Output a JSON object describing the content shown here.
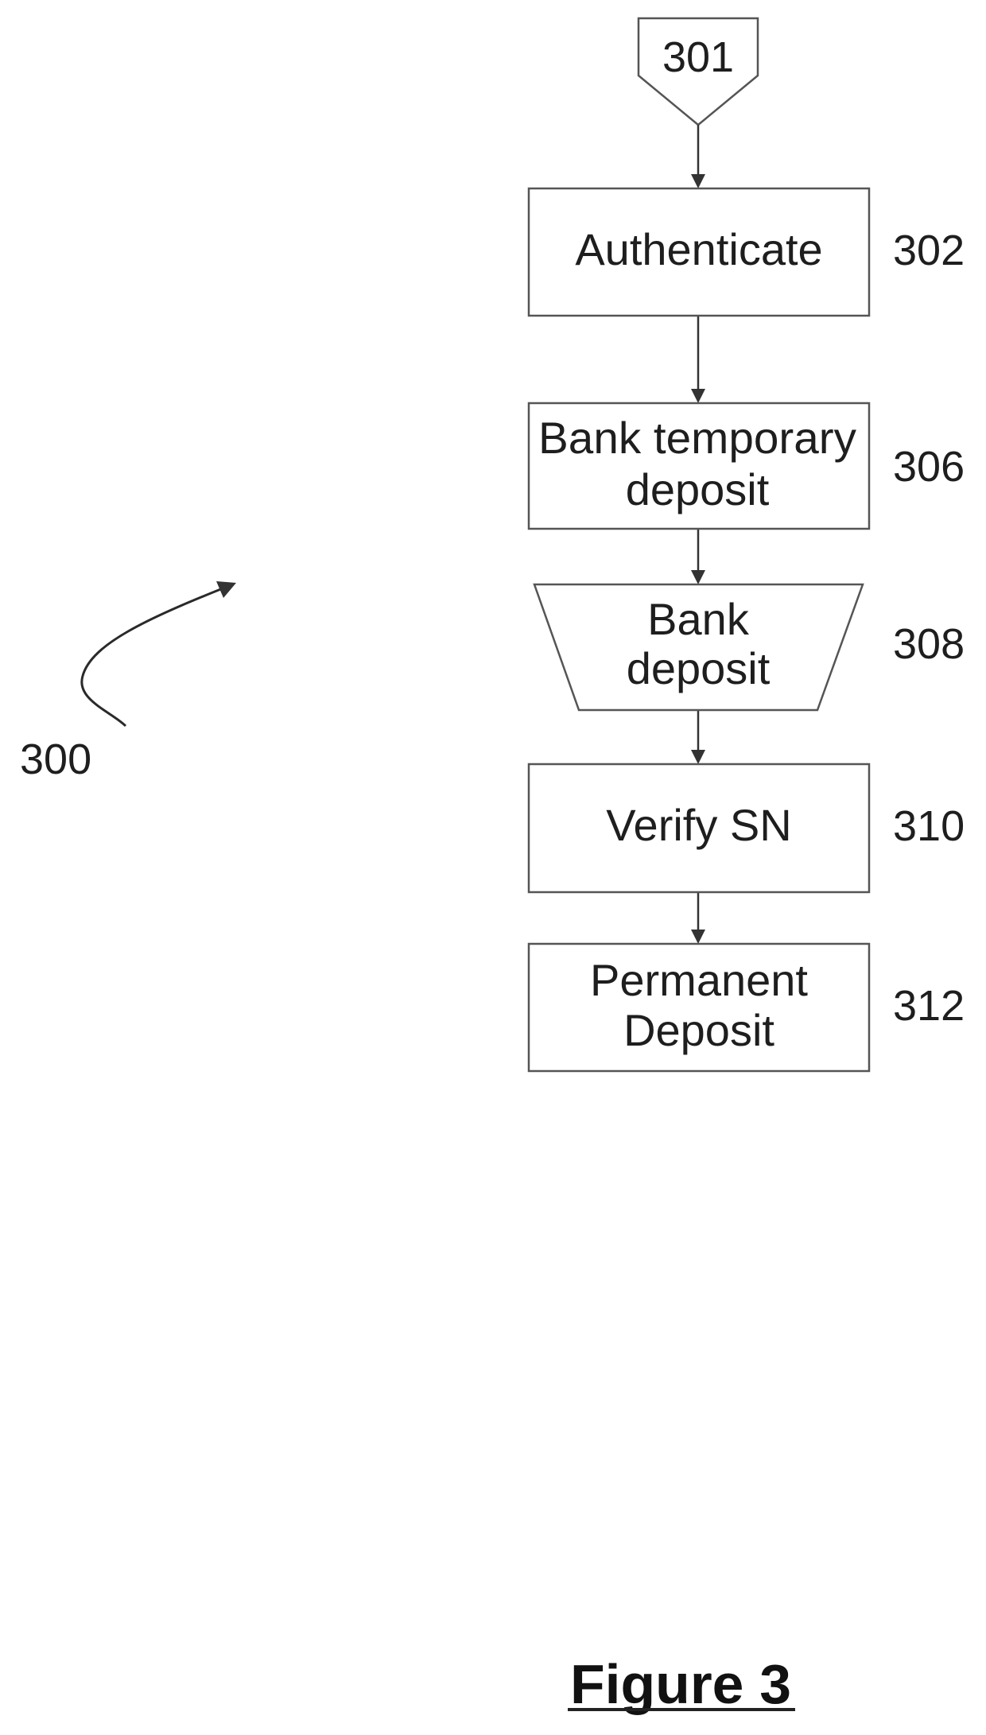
{
  "figure": {
    "caption": "Figure 3",
    "reference": "300"
  },
  "flow": {
    "start": {
      "ref": "301",
      "shape": "off-page-connector"
    },
    "steps": [
      {
        "ref": "302",
        "shape": "rectangle",
        "lines": [
          "Authenticate"
        ]
      },
      {
        "ref": "306",
        "shape": "rectangle",
        "lines": [
          "Bank temporary",
          "deposit"
        ]
      },
      {
        "ref": "308",
        "shape": "trapezoid",
        "lines": [
          "Bank",
          "deposit"
        ]
      },
      {
        "ref": "310",
        "shape": "rectangle",
        "lines": [
          "Verify SN"
        ]
      },
      {
        "ref": "312",
        "shape": "rectangle",
        "lines": [
          "Permanent",
          "Deposit"
        ]
      }
    ],
    "edges": [
      [
        "301",
        "302"
      ],
      [
        "302",
        "306"
      ],
      [
        "306",
        "308"
      ],
      [
        "308",
        "310"
      ],
      [
        "310",
        "312"
      ]
    ]
  }
}
